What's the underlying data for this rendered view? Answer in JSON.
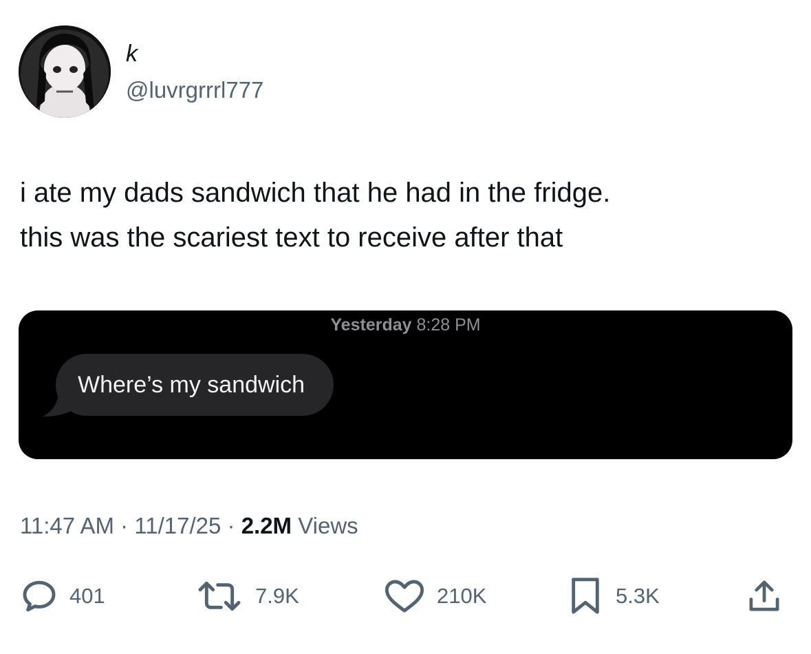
{
  "author": {
    "display_name": "k",
    "handle": "@luvrgrrrl777"
  },
  "tweet": {
    "line1": "i ate my dads sandwich that he had in the fridge.",
    "line2": "this was the scariest text to receive after that"
  },
  "media": {
    "timestamp_day": "Yesterday",
    "timestamp_time": "8:28 PM",
    "message": "Where’s my sandwich",
    "background_color": "#000000",
    "bubble_color": "#262629"
  },
  "meta": {
    "time": "11:47 AM",
    "separator": "·",
    "date": "11/17/25",
    "views_count": "2.2M",
    "views_label": "Views"
  },
  "actions": {
    "reply_count": "401",
    "retweet_count": "7.9K",
    "like_count": "210K",
    "bookmark_count": "5.3K"
  },
  "icons": [
    "reply-icon",
    "retweet-icon",
    "like-icon",
    "bookmark-icon",
    "share-icon"
  ]
}
